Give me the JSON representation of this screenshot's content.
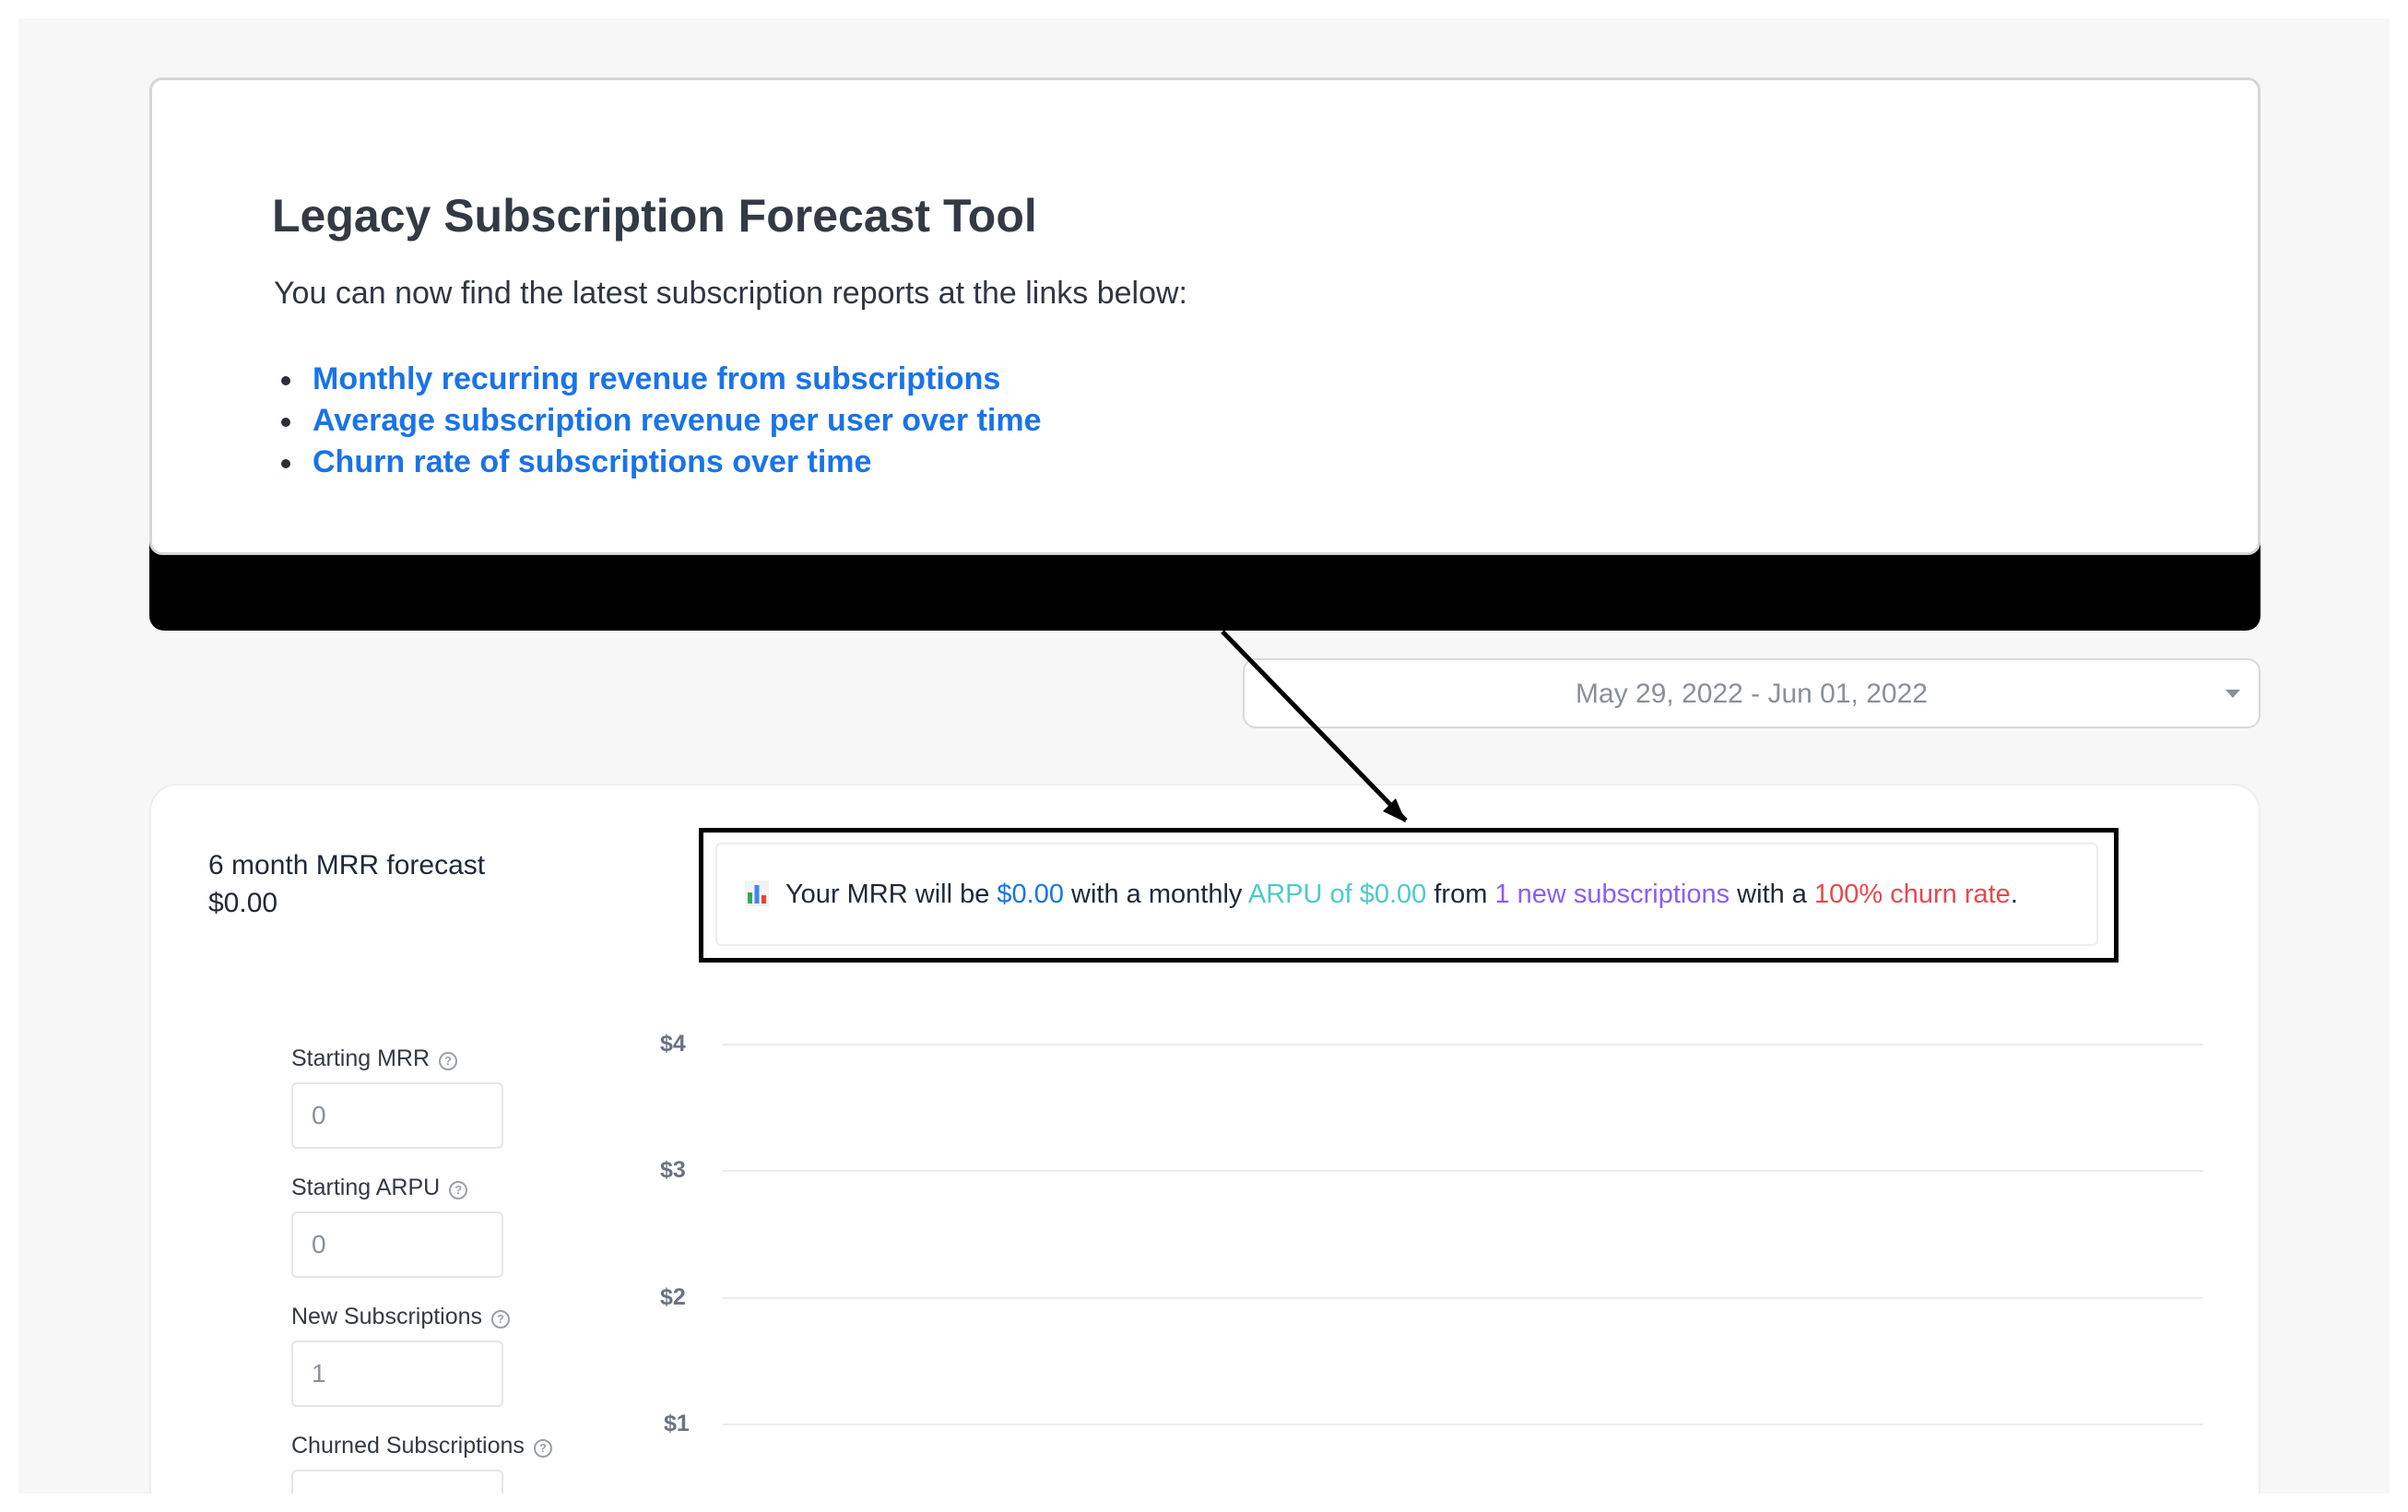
{
  "banner": {
    "title": "Legacy Subscription Forecast Tool",
    "subtitle": "You can now find the latest subscription reports at the links below:",
    "links": [
      "Monthly recurring revenue from subscriptions",
      "Average subscription revenue per user over time",
      "Churn rate of subscriptions over time"
    ]
  },
  "date_range": {
    "label": "May 29, 2022  -  Jun 01, 2022"
  },
  "forecast": {
    "label": "6 month MRR forecast",
    "value": "$0.00"
  },
  "summary": {
    "p1": "Your MRR will be ",
    "mrr": "$0.00",
    "p2": " with a monthly ",
    "arpu": "ARPU of $0.00",
    "p3": " from ",
    "new_subs": "1 new subscriptions",
    "p4": " with a ",
    "churn": "100% churn rate",
    "p5": ".",
    "icon": "bar-chart-icon"
  },
  "inputs": {
    "starting_mrr": {
      "label": "Starting MRR",
      "placeholder": "0"
    },
    "starting_arpu": {
      "label": "Starting ARPU",
      "placeholder": "0"
    },
    "new_subscriptions": {
      "label": "New Subscriptions",
      "placeholder": "1"
    },
    "churned_subscriptions": {
      "label": "Churned Subscriptions",
      "placeholder": ""
    }
  },
  "chart_data": {
    "type": "line",
    "title": "",
    "xlabel": "",
    "ylabel": "",
    "y_ticks": [
      "$4",
      "$3",
      "$2",
      "$1"
    ],
    "ylim": [
      0,
      4
    ],
    "grid": true,
    "series": []
  },
  "colors": {
    "link": "#1a73e8",
    "mrr": "#1a73e8",
    "arpu": "#4ccbc8",
    "new_subs": "#8b5cf6",
    "churn": "#e5484d"
  }
}
